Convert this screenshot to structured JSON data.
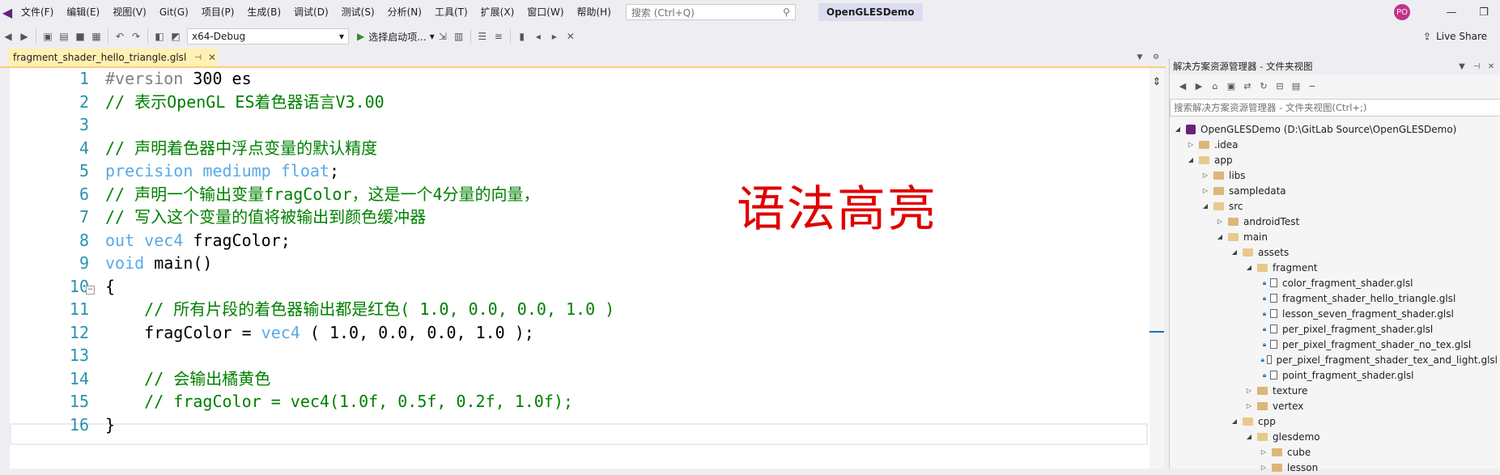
{
  "menubar": {
    "items": [
      "文件(F)",
      "编辑(E)",
      "视图(V)",
      "Git(G)",
      "项目(P)",
      "生成(B)",
      "调试(D)",
      "测试(S)",
      "分析(N)",
      "工具(T)",
      "扩展(X)",
      "窗口(W)",
      "帮助(H)"
    ],
    "search_placeholder": "搜索 (Ctrl+Q)",
    "solution_name": "OpenGLESDemo",
    "avatar_initials": "PO"
  },
  "toolbar": {
    "config": "x64-Debug",
    "start_label": "选择启动项...",
    "live_share": "Live Share"
  },
  "tab": {
    "title": "fragment_shader_hello_triangle.glsl",
    "pin": "⊣",
    "close": "✕"
  },
  "editor": {
    "lines": [
      {
        "n": "1"
      },
      {
        "n": "2"
      },
      {
        "n": "3"
      },
      {
        "n": "4"
      },
      {
        "n": "5"
      },
      {
        "n": "6"
      },
      {
        "n": "7"
      },
      {
        "n": "8"
      },
      {
        "n": "9"
      },
      {
        "n": "10"
      },
      {
        "n": "11"
      },
      {
        "n": "12"
      },
      {
        "n": "13"
      },
      {
        "n": "14"
      },
      {
        "n": "15"
      },
      {
        "n": "16"
      }
    ],
    "code": {
      "l1a": "#version",
      "l1b": " 300 es",
      "l2": "// 表示OpenGL ES着色器语言V3.00",
      "l4": "// 声明着色器中浮点变量的默认精度",
      "l5a": "precision mediump float",
      "l5b": ";",
      "l6": "// 声明一个输出变量fragColor，这是一个4分量的向量，",
      "l7": "// 写入这个变量的值将被输出到颜色缓冲器",
      "l8a": "out vec4",
      "l8b": " fragColor;",
      "l9a": "void",
      "l9b": " main()",
      "l10": "{",
      "l11": "    // 所有片段的着色器输出都是红色( 1.0, 0.0, 0.0, 1.0 )",
      "l12a": "    fragColor = ",
      "l12b": "vec4",
      "l12c": " ( 1.0, 0.0, 0.0, 1.0 );",
      "l14": "    // 会输出橘黄色",
      "l15": "    // fragColor = vec4(1.0f, 0.5f, 0.2f, 1.0f);",
      "l16": "}"
    },
    "overlay_text": "语法高亮"
  },
  "solution_explorer": {
    "title": "解决方案资源管理器 - 文件夹视图",
    "search_placeholder": "搜索解决方案资源管理器 - 文件夹视图(Ctrl+;)",
    "tree": [
      {
        "label": "OpenGLESDemo (D:\\GitLab Source\\OpenGLESDemo)"
      },
      {
        "label": ".idea"
      },
      {
        "label": "app"
      },
      {
        "label": "libs"
      },
      {
        "label": "sampledata"
      },
      {
        "label": "src"
      },
      {
        "label": "androidTest"
      },
      {
        "label": "main"
      },
      {
        "label": "assets"
      },
      {
        "label": "fragment"
      },
      {
        "label": "color_fragment_shader.glsl"
      },
      {
        "label": "fragment_shader_hello_triangle.glsl"
      },
      {
        "label": "lesson_seven_fragment_shader.glsl"
      },
      {
        "label": "per_pixel_fragment_shader.glsl"
      },
      {
        "label": "per_pixel_fragment_shader_no_tex.glsl"
      },
      {
        "label": "per_pixel_fragment_shader_tex_and_light.glsl"
      },
      {
        "label": "point_fragment_shader.glsl"
      },
      {
        "label": "texture"
      },
      {
        "label": "vertex"
      },
      {
        "label": "cpp"
      },
      {
        "label": "glesdemo"
      },
      {
        "label": "cube"
      },
      {
        "label": "lesson"
      }
    ]
  },
  "colors": {
    "keyword": "#5aa9e6",
    "comment": "#008000",
    "line_number": "#2b91af",
    "overlay": "#e00000",
    "tab_active": "#fff0b3"
  }
}
